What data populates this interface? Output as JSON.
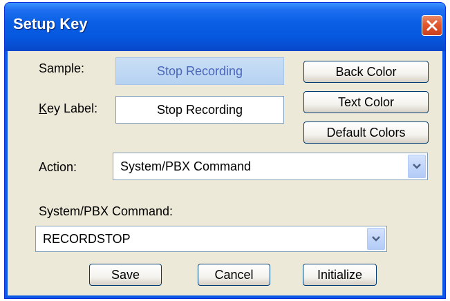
{
  "dialog": {
    "title": "Setup Key",
    "close_icon": "close-icon"
  },
  "form": {
    "sample_label": "Sample:",
    "sample_preview": "Stop Recording",
    "key_label_mnemonic": "K",
    "key_label_rest": "ey Label:",
    "key_label_value": "Stop Recording",
    "action_label": "Action:",
    "action_value": "System/PBX Command",
    "command_label": "System/PBX Command:",
    "command_value": "RECORDSTOP",
    "dropdown_icon": "chevron-down-icon"
  },
  "color_buttons": {
    "back_color": "Back Color",
    "text_color": "Text Color",
    "default_colors": "Default Colors"
  },
  "footer_buttons": {
    "save": "Save",
    "cancel": "Cancel",
    "initialize": "Initialize"
  },
  "colors": {
    "titlebar": "#0a5fe4",
    "client_bg": "#ece9d8",
    "close_button": "#e2572e",
    "sample_bg": "#c2daf5",
    "sample_text": "#4a67b8"
  }
}
